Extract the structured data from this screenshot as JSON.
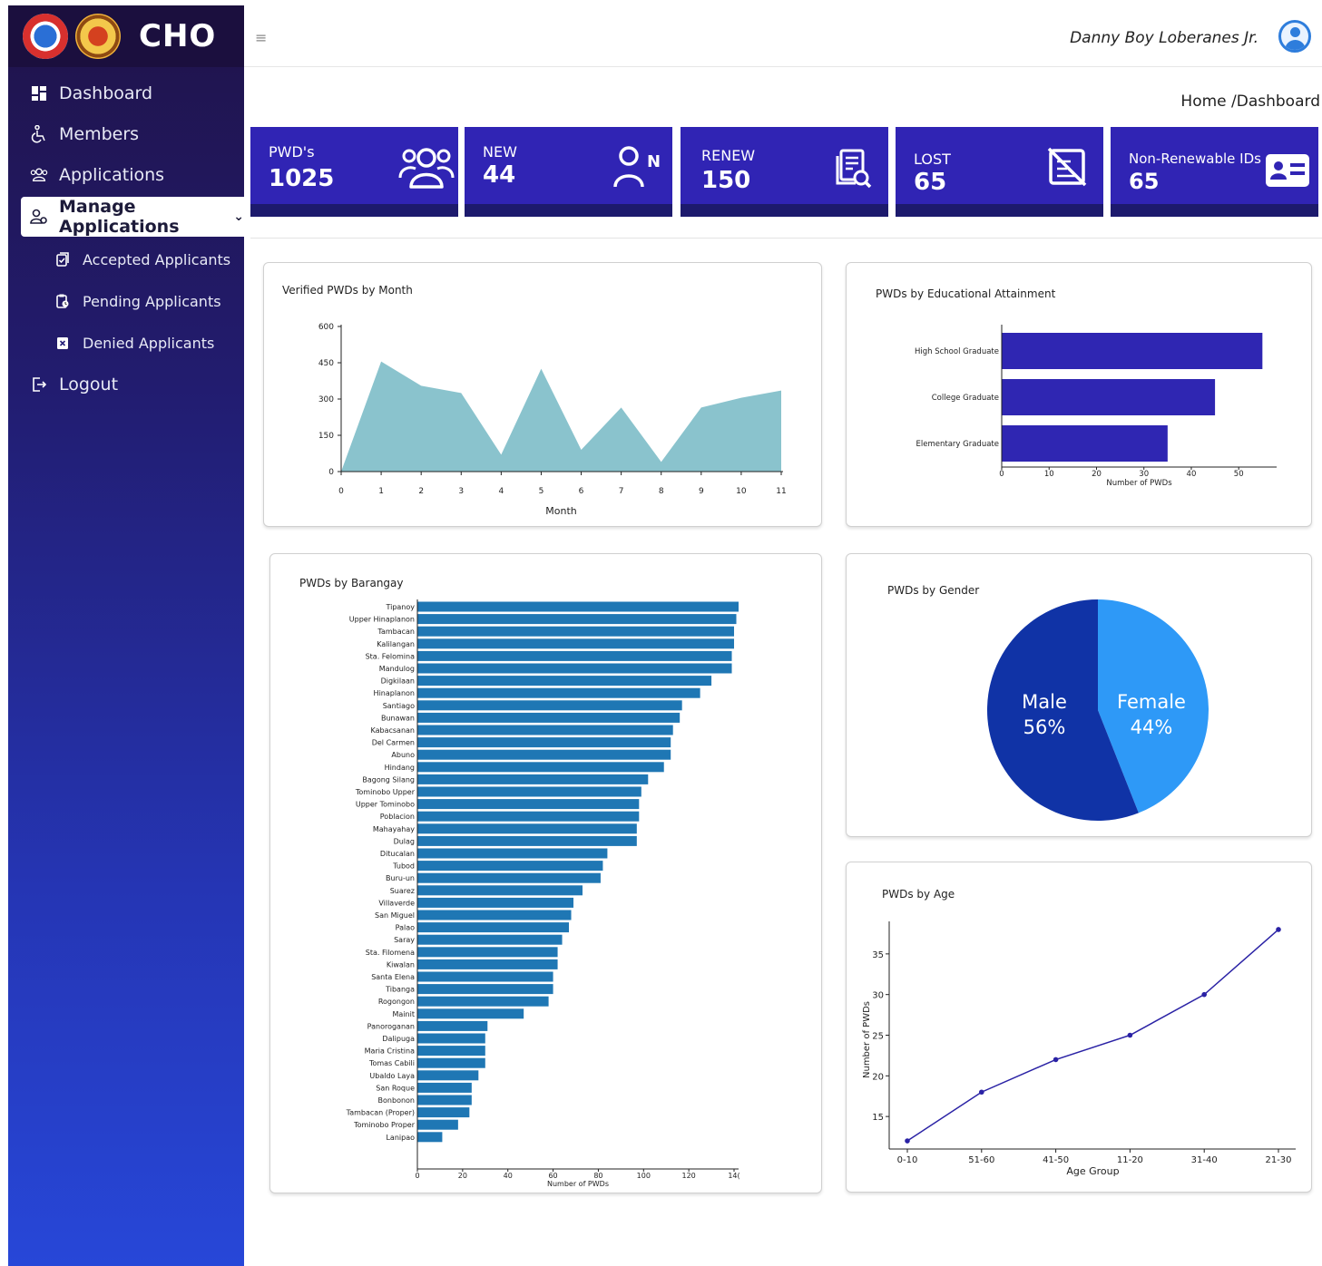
{
  "brand": {
    "title": "CHO"
  },
  "sidebar": {
    "items": [
      {
        "label": "Dashboard",
        "icon": "dashboard-icon"
      },
      {
        "label": "Members",
        "icon": "wheelchair-icon"
      },
      {
        "label": "Applications",
        "icon": "users-icon"
      },
      {
        "label": "Manage Applications",
        "icon": "manage-users-icon"
      },
      {
        "label": "Accepted Applicants",
        "icon": "doc-check-icon"
      },
      {
        "label": "Pending Applicants",
        "icon": "clipboard-clock-icon"
      },
      {
        "label": "Denied Applicants",
        "icon": "doc-x-icon"
      },
      {
        "label": "Logout",
        "icon": "logout-icon"
      }
    ]
  },
  "topbar": {
    "menu_glyph": "≡",
    "user_name": "Danny Boy Loberanes Jr."
  },
  "breadcrumb": "Home /Dashboard",
  "stats": [
    {
      "label": "PWD's",
      "value": "1025",
      "icon": "users-icon"
    },
    {
      "label": "NEW",
      "value": "44",
      "icon": "new-user-icon"
    },
    {
      "label": "RENEW",
      "value": "150",
      "icon": "renew-doc-icon"
    },
    {
      "label": "LOST",
      "value": "65",
      "icon": "lost-card-icon"
    },
    {
      "label": "Non-Renewable IDs",
      "value": "65",
      "icon": "id-card-icon"
    }
  ],
  "colors": {
    "card": "#3024b4",
    "card_base": "#1d1a6d",
    "area": "#8ac3cd",
    "edu": "#2f26b2",
    "barangay": "#1f77b4",
    "male": "#1033a6",
    "female": "#2e99f7",
    "age_line": "#2a22a5"
  },
  "chart_data": [
    {
      "type": "area",
      "title": "Verified PWDs by Month",
      "xlabel": "Month",
      "ylabel": "",
      "x": [
        0,
        1,
        2,
        3,
        4,
        5,
        6,
        7,
        8,
        9,
        10,
        11
      ],
      "values": [
        0,
        455,
        355,
        325,
        70,
        425,
        90,
        265,
        40,
        265,
        305,
        335
      ],
      "ylim": [
        0,
        600
      ],
      "yticks": [
        0,
        150,
        300,
        450,
        600
      ],
      "xticks": [
        0,
        1,
        2,
        3,
        4,
        5,
        6,
        7,
        8,
        9,
        10,
        11
      ]
    },
    {
      "type": "bar",
      "orientation": "horizontal",
      "title": "PWDs by Educational Attainment",
      "xlabel": "Number of PWDs",
      "categories": [
        "High School Graduate",
        "College Graduate",
        "Elementary Graduate"
      ],
      "values": [
        55,
        45,
        35
      ],
      "xlim": [
        0,
        58
      ],
      "xticks": [
        0,
        10,
        20,
        30,
        40,
        50
      ]
    },
    {
      "type": "bar",
      "orientation": "horizontal",
      "title": "PWDs by Barangay",
      "xlabel": "Number of PWDs",
      "categories": [
        "Tipanoy",
        "Upper Hinaplanon",
        "Tambacan",
        "Kalilangan",
        "Sta. Felomina",
        "Mandulog",
        "Digkilaan",
        "Hinaplanon",
        "Santiago",
        "Bunawan",
        "Kabacsanan",
        "Del Carmen",
        "Abuno",
        "Hindang",
        "Bagong Silang",
        "Tominobo Upper",
        "Upper Tominobo",
        "Poblacion",
        "Mahayahay",
        "Dulag",
        "Ditucalan",
        "Tubod",
        "Buru-un",
        "Suarez",
        "Villaverde",
        "San Miguel",
        "Palao",
        "Saray",
        "Sta. Filomena",
        "Kiwalan",
        "Santa Elena",
        "Tibanga",
        "Rogongon",
        "Mainit",
        "Panoroganan",
        "Dalipuga",
        "Maria Cristina",
        "Tomas Cabili",
        "Ubaldo Laya",
        "San Roque",
        "Bonbonon",
        "Tambacan (Proper)",
        "Tominobo Proper",
        "Lanipao"
      ],
      "values": [
        142,
        141,
        140,
        140,
        139,
        139,
        130,
        125,
        117,
        116,
        113,
        112,
        112,
        109,
        102,
        99,
        98,
        98,
        97,
        97,
        84,
        82,
        81,
        73,
        69,
        68,
        67,
        64,
        62,
        62,
        60,
        60,
        58,
        47,
        31,
        30,
        30,
        30,
        27,
        24,
        24,
        23,
        18,
        11
      ],
      "xlim": [
        0,
        142
      ],
      "xticks": [
        0,
        20,
        40,
        60,
        80,
        100,
        120,
        140
      ],
      "xtick_labels": [
        "0",
        "20",
        "40",
        "60",
        "80",
        "100",
        "120",
        "14("
      ]
    },
    {
      "type": "pie",
      "title": "PWDs by Gender",
      "labels": [
        "Male",
        "Female"
      ],
      "values": [
        56,
        44
      ],
      "value_labels": [
        "56%",
        "44%"
      ]
    },
    {
      "type": "line",
      "title": "PWDs by Age",
      "xlabel": "Age Group",
      "ylabel": "Number of PWDs",
      "categories": [
        "0-10",
        "51-60",
        "41-50",
        "11-20",
        "31-40",
        "21-30"
      ],
      "values": [
        12,
        18,
        22,
        25,
        30,
        38
      ],
      "ylim": [
        11,
        39
      ],
      "yticks": [
        15,
        20,
        25,
        30,
        35
      ]
    }
  ]
}
